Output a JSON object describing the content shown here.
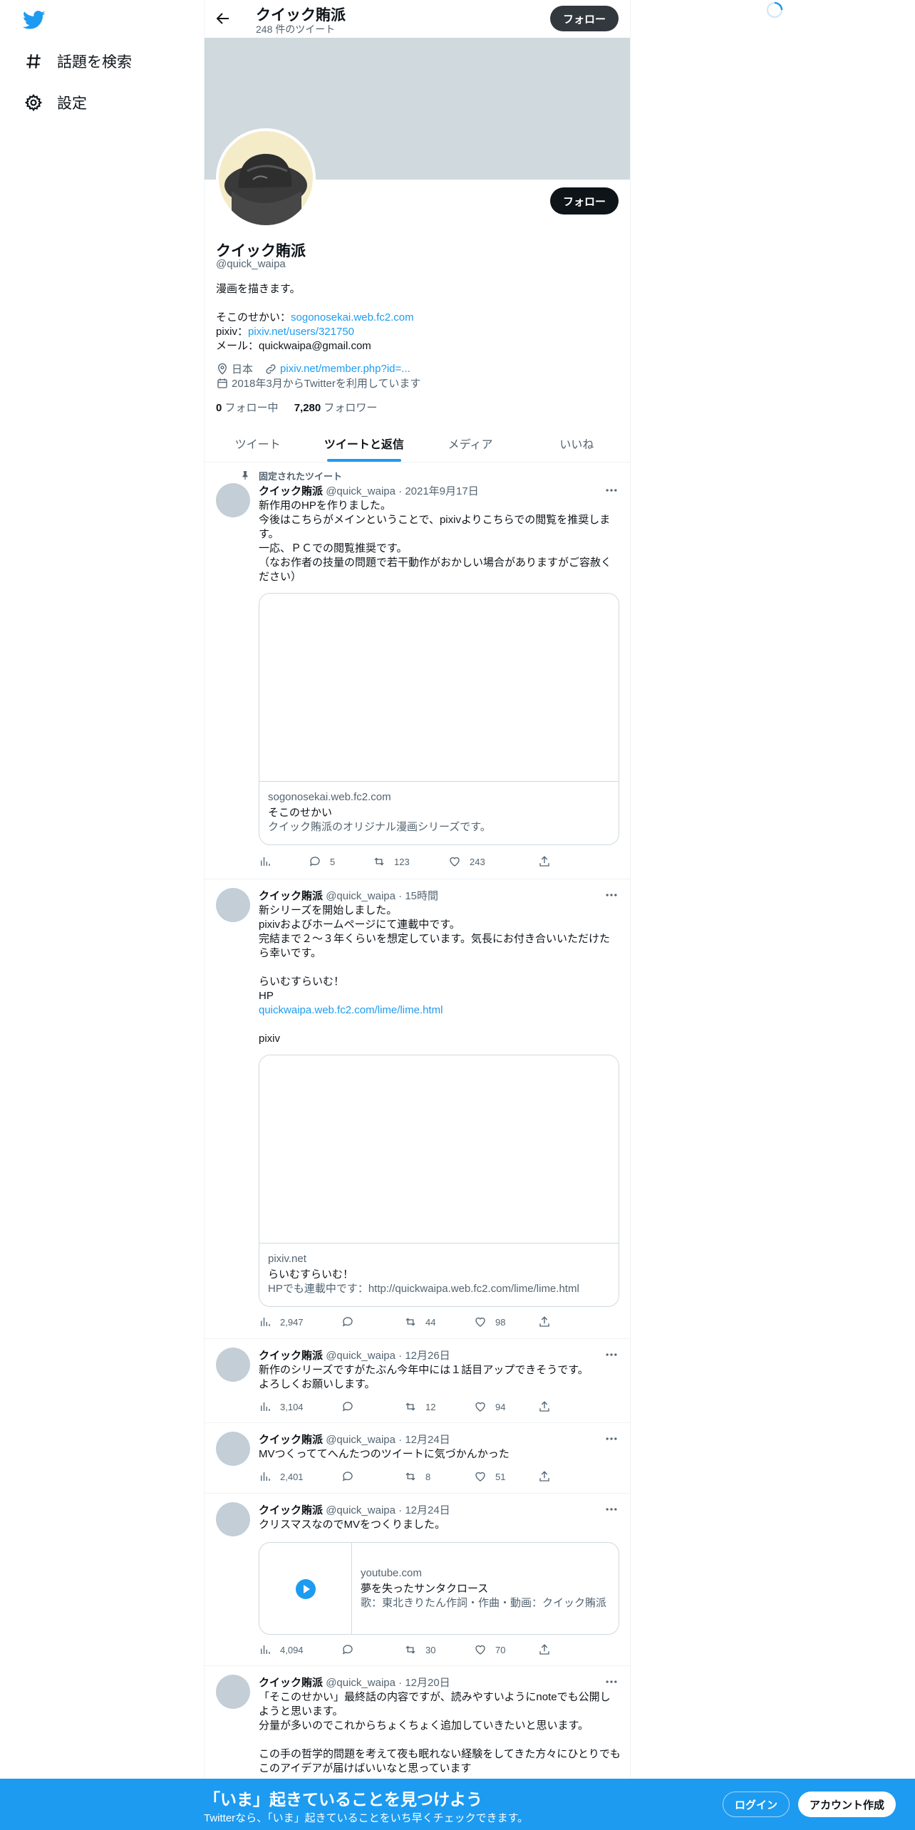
{
  "nav": {
    "logo_icon": "twitter-bird-icon",
    "items": [
      {
        "label": "話題を検索",
        "icon": "hashtag-icon"
      },
      {
        "label": "設定",
        "icon": "gear-icon"
      }
    ]
  },
  "header": {
    "name": "クイック賄派",
    "tweet_count": "248 件のツイート",
    "follow_label": "フォロー"
  },
  "profile": {
    "follow_label": "フォロー",
    "name": "クイック賄派",
    "handle": "@quick_waipa",
    "bio_line1": "漫画を描きます。",
    "site_prefix": "そこのせかい：",
    "site_link": "sogonosekai.web.fc2.com",
    "pixiv_prefix": "pixiv：",
    "pixiv_link": "pixiv.net/users/321750",
    "mail_line": "メール：quickwaipa@gmail.com",
    "location": "日本",
    "url": "pixiv.net/member.php?id=...",
    "joined": "2018年3月からTwitterを利用しています",
    "following_count": "0",
    "following_label": "フォロー中",
    "followers_count": "7,280",
    "followers_label": "フォロワー"
  },
  "tabs": [
    "ツイート",
    "ツイートと返信",
    "メディア",
    "いいね"
  ],
  "pinned_label": "固定されたツイート",
  "tweets": [
    {
      "name": "クイック賄派",
      "handle": "@quick_waipa",
      "time": "2021年9月17日",
      "text": "新作用のHPを作りました。\n今後はこちらがメインということで、pixivよりこちらでの閲覧を推奨します。\n一応、ＰＣでの閲覧推奨です。\n（なお作者の技量の問題で若干動作がおかしい場合がありますがご容赦ください）",
      "card": {
        "domain": "sogonosekai.web.fc2.com",
        "title": "そこのせかい",
        "desc": "クイック賄派のオリジナル漫画シリーズです。"
      },
      "views": "",
      "replies": "5",
      "retweets": "123",
      "likes": "243"
    },
    {
      "name": "クイック賄派",
      "handle": "@quick_waipa",
      "time": "15時間",
      "text": "新シリーズを開始しました。\npixivおよびホームページにて連載中です。\n完結まで２～３年くらいを想定しています。気長にお付き合いいただけたら幸いです。\n\nらいむすらいむ！\nHP",
      "link": "quickwaipa.web.fc2.com/lime/lime.html",
      "text2": "pixiv",
      "card": {
        "domain": "pixiv.net",
        "title": "らいむすらいむ！",
        "desc": "HPでも連載中です：http://quickwaipa.web.fc2.com/lime/lime.html"
      },
      "views": "2,947",
      "replies": "",
      "retweets": "44",
      "likes": "98"
    },
    {
      "name": "クイック賄派",
      "handle": "@quick_waipa",
      "time": "12月26日",
      "text": "新作のシリーズですがたぶん今年中には１話目アップできそうです。\nよろしくお願いします。",
      "views": "3,104",
      "replies": "",
      "retweets": "12",
      "likes": "94"
    },
    {
      "name": "クイック賄派",
      "handle": "@quick_waipa",
      "time": "12月24日",
      "text": "MVつくっててへんたつのツイートに気づかんかった",
      "views": "2,401",
      "replies": "",
      "retweets": "8",
      "likes": "51"
    },
    {
      "name": "クイック賄派",
      "handle": "@quick_waipa",
      "time": "12月24日",
      "text": "クリスマスなのでMVをつくりました。",
      "card": {
        "domain": "youtube.com",
        "title": "夢を失ったサンタクロース",
        "desc": "歌：東北きりたん作詞・作曲・動画：クイック賄派"
      },
      "views": "4,094",
      "replies": "",
      "retweets": "30",
      "likes": "70"
    },
    {
      "name": "クイック賄派",
      "handle": "@quick_waipa",
      "time": "12月20日",
      "text": "「そこのせかい」最終話の内容ですが、読みやすいようにnoteでも公開しようと思います。\n分量が多いのでこれからちょくちょく追加していきたいと思います。\n\nこの手の哲学的問題を考えて夜も眠れない経験をしてきた方々にひとりでもこのアイデアが届けばいいなと思っています"
    }
  ],
  "bottom": {
    "title": "「いま」起きていることを見つけよう",
    "subtitle": "Twitterなら、「いま」起きていることをいち早くチェックできます。",
    "login": "ログイン",
    "signup": "アカウント作成"
  }
}
